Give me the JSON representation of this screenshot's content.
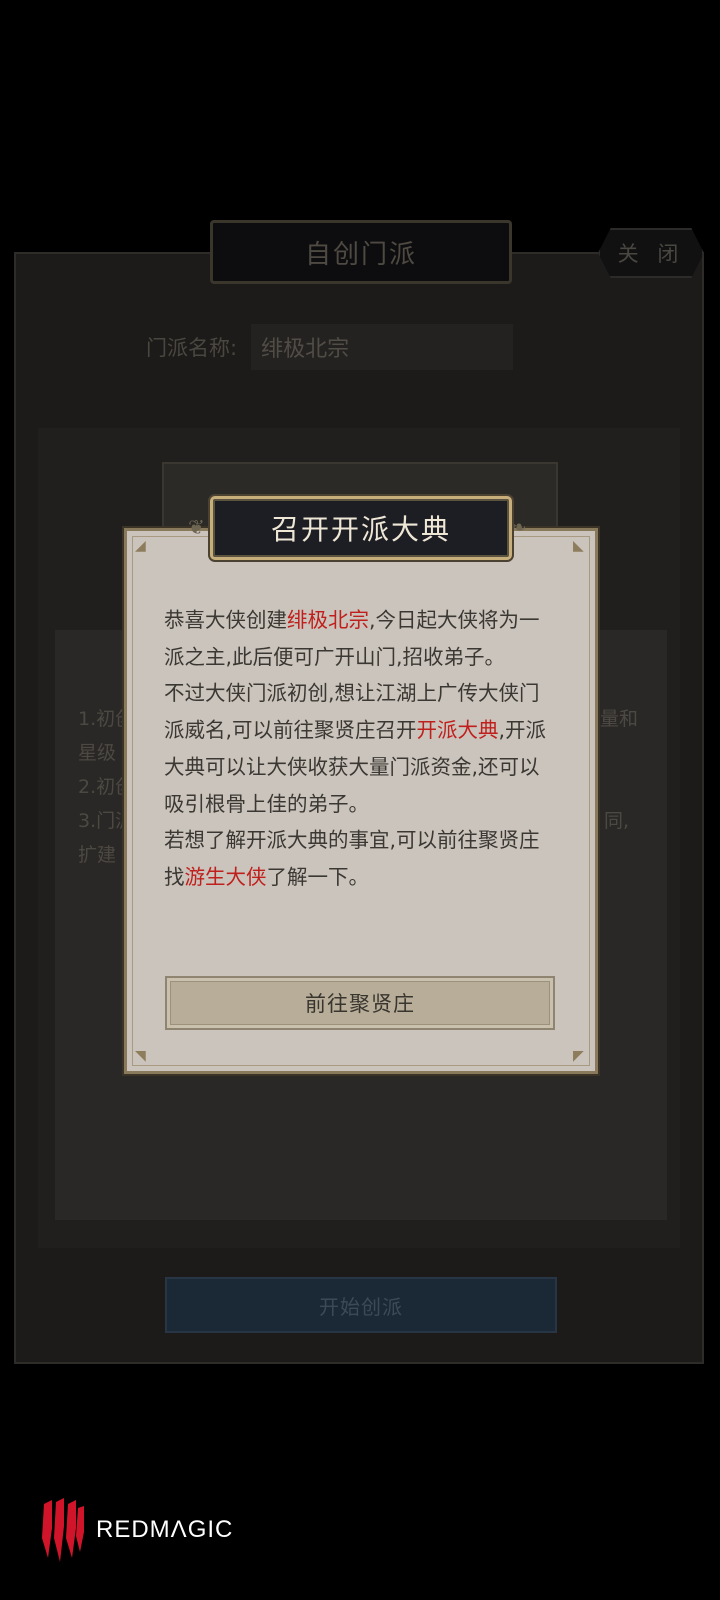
{
  "background_screen": {
    "title": "自创门派",
    "close_label": "关 闭",
    "name_label": "门派名称:",
    "name_value": "绯极北宗",
    "desc_fragments": [
      "1.初创",
      "星级",
      "2.初创",
      "3.门派",
      "扩建",
      "量和",
      "同,"
    ],
    "start_button_label": "开始创派"
  },
  "dialog": {
    "title": "召开开派大典",
    "message": {
      "p1_before": "恭喜大侠创建",
      "p1_highlight": "绯极北宗",
      "p1_after": ",今日起大侠将为一派之主,此后便可广开山门,招收弟子。",
      "p2_before": "不过大侠门派初创,想让江湖上广传大侠门派威名,可以前往聚贤庄召开",
      "p2_highlight": "开派大典",
      "p2_after": ",开派大典可以让大侠收获大量门派资金,还可以吸引根骨上佳的弟子。",
      "p3_before": "若想了解开派大典的事宜,可以前往聚贤庄找",
      "p3_highlight": "游生大侠",
      "p3_after": "了解一下。"
    },
    "button_label": "前往聚贤庄"
  },
  "watermark": {
    "brand": "REDMΛGIC"
  },
  "colors": {
    "highlight": "#c0201d",
    "dialog_bg": "#cbc4bc",
    "title_plate": "#1d1d24"
  }
}
